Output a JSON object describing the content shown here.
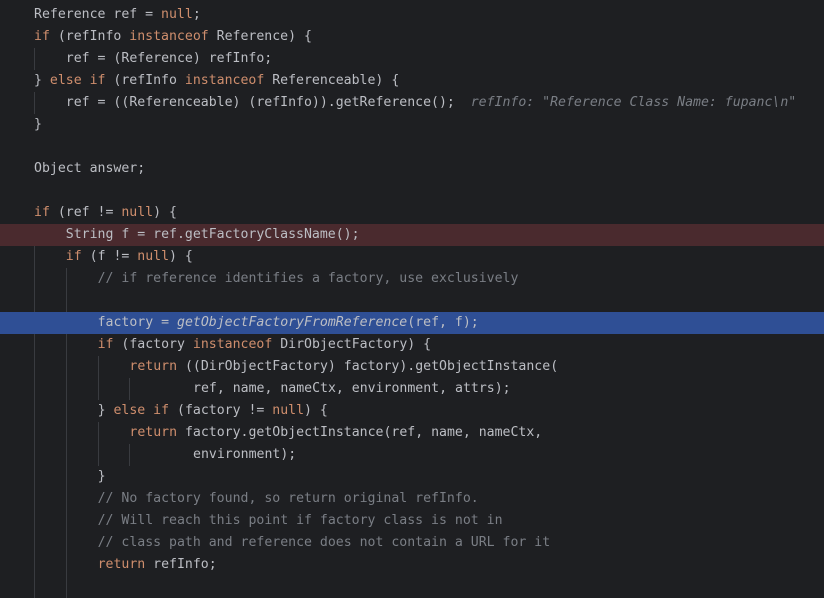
{
  "colors": {
    "background": "#1e1f22",
    "text": "#bcbec4",
    "keyword": "#cf8e6d",
    "comment": "#7a7e85",
    "breakpoint_line": "#4a2a2e",
    "execution_line": "#2f4f95"
  },
  "lines": [
    {
      "indent": 0,
      "state": "normal",
      "tokens": [
        [
          "id",
          "Reference ref = "
        ],
        [
          "kw",
          "null"
        ],
        [
          "id",
          ";"
        ]
      ]
    },
    {
      "indent": 0,
      "state": "normal",
      "tokens": [
        [
          "kw",
          "if"
        ],
        [
          "id",
          " (refInfo "
        ],
        [
          "kw",
          "instanceof"
        ],
        [
          "id",
          " Reference) {"
        ]
      ]
    },
    {
      "indent": 1,
      "state": "normal",
      "tokens": [
        [
          "id",
          "ref = (Reference) refInfo;"
        ]
      ]
    },
    {
      "indent": 0,
      "state": "normal",
      "tokens": [
        [
          "id",
          "} "
        ],
        [
          "kw",
          "else if"
        ],
        [
          "id",
          " (refInfo "
        ],
        [
          "kw",
          "instanceof"
        ],
        [
          "id",
          " Referenceable) {"
        ]
      ]
    },
    {
      "indent": 1,
      "state": "normal",
      "tokens": [
        [
          "id",
          "ref = ((Referenceable) (refInfo)).getReference();"
        ],
        [
          "hint",
          "  refInfo: \"Reference Class Name: fupanc\\n\""
        ]
      ]
    },
    {
      "indent": 0,
      "state": "normal",
      "tokens": [
        [
          "id",
          "}"
        ]
      ]
    },
    {
      "indent": 0,
      "state": "normal",
      "tokens": []
    },
    {
      "indent": 0,
      "state": "normal",
      "tokens": [
        [
          "id",
          "Object answer;"
        ]
      ]
    },
    {
      "indent": 0,
      "state": "normal",
      "tokens": []
    },
    {
      "indent": 0,
      "state": "normal",
      "tokens": [
        [
          "kw",
          "if"
        ],
        [
          "id",
          " (ref != "
        ],
        [
          "kw",
          "null"
        ],
        [
          "id",
          ") {"
        ]
      ]
    },
    {
      "indent": 1,
      "state": "breakpoint",
      "tokens": [
        [
          "id",
          "String f = ref.getFactoryClassName();"
        ]
      ]
    },
    {
      "indent": 1,
      "state": "normal",
      "tokens": [
        [
          "kw",
          "if"
        ],
        [
          "id",
          " (f != "
        ],
        [
          "kw",
          "null"
        ],
        [
          "id",
          ") {"
        ]
      ]
    },
    {
      "indent": 2,
      "state": "normal",
      "tokens": [
        [
          "cmt",
          "// if reference identifies a factory, use exclusively"
        ]
      ]
    },
    {
      "indent": 2,
      "state": "normal",
      "tokens": []
    },
    {
      "indent": 2,
      "state": "current",
      "tokens": [
        [
          "id",
          "factory = "
        ],
        [
          "static-it",
          "getObjectFactoryFromReference"
        ],
        [
          "id",
          "(ref, f);"
        ]
      ]
    },
    {
      "indent": 2,
      "state": "normal",
      "tokens": [
        [
          "kw",
          "if"
        ],
        [
          "id",
          " (factory "
        ],
        [
          "kw",
          "instanceof"
        ],
        [
          "id",
          " DirObjectFactory) {"
        ]
      ]
    },
    {
      "indent": 3,
      "state": "normal",
      "tokens": [
        [
          "kw",
          "return"
        ],
        [
          "id",
          " ((DirObjectFactory) factory).getObjectInstance("
        ]
      ]
    },
    {
      "indent": 5,
      "state": "normal",
      "tokens": [
        [
          "id",
          "ref, name, nameCtx, environment, attrs);"
        ]
      ]
    },
    {
      "indent": 2,
      "state": "normal",
      "tokens": [
        [
          "id",
          "} "
        ],
        [
          "kw",
          "else if"
        ],
        [
          "id",
          " (factory != "
        ],
        [
          "kw",
          "null"
        ],
        [
          "id",
          ") {"
        ]
      ]
    },
    {
      "indent": 3,
      "state": "normal",
      "tokens": [
        [
          "kw",
          "return"
        ],
        [
          "id",
          " factory.getObjectInstance(ref, name, nameCtx,"
        ]
      ]
    },
    {
      "indent": 5,
      "state": "normal",
      "tokens": [
        [
          "id",
          "environment);"
        ]
      ]
    },
    {
      "indent": 2,
      "state": "normal",
      "tokens": [
        [
          "id",
          "}"
        ]
      ]
    },
    {
      "indent": 2,
      "state": "normal",
      "tokens": [
        [
          "cmt",
          "// No factory found, so return original refInfo."
        ]
      ]
    },
    {
      "indent": 2,
      "state": "normal",
      "tokens": [
        [
          "cmt",
          "// Will reach this point if factory class is not in"
        ]
      ]
    },
    {
      "indent": 2,
      "state": "normal",
      "tokens": [
        [
          "cmt",
          "// class path and reference does not contain a URL for it"
        ]
      ]
    },
    {
      "indent": 2,
      "state": "normal",
      "tokens": [
        [
          "kw",
          "return"
        ],
        [
          "id",
          " refInfo;"
        ]
      ]
    },
    {
      "indent": 2,
      "state": "normal",
      "tokens": []
    }
  ]
}
